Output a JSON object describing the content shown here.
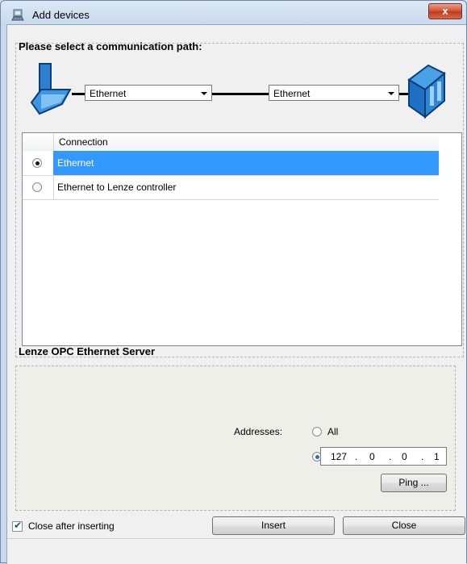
{
  "window": {
    "title": "Add devices",
    "close_glyph": "x"
  },
  "path": {
    "heading": "Please select a communication path:",
    "left_combo": "Ethernet",
    "right_combo": "Ethernet"
  },
  "connections": {
    "header": "Connection",
    "rows": [
      {
        "label": "Ethernet",
        "selected": true
      },
      {
        "label": "Ethernet to Lenze controller",
        "selected": false
      }
    ]
  },
  "server": {
    "heading": "Lenze OPC Ethernet Server",
    "addresses_label": "Addresses:",
    "all_label": "All",
    "ip": [
      "127",
      "0",
      "0",
      "1"
    ],
    "ping_label": "Ping ..."
  },
  "footer": {
    "close_after_label": "Close after inserting",
    "insert_label": "Insert",
    "close_label": "Close"
  },
  "colors": {
    "selection": "#3399ff",
    "titlebar_close": "#c33a1d"
  }
}
